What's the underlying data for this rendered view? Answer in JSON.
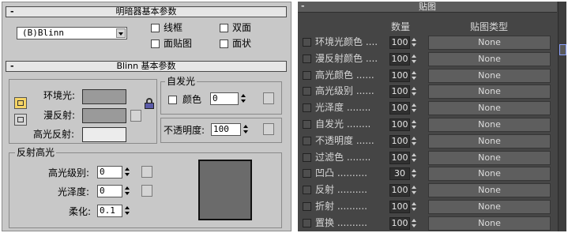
{
  "shader_rollout": {
    "title": "明暗器基本参数",
    "collapse_symbol": "-",
    "shader_value": "(B)Blinn",
    "options": [
      {
        "label": "线框",
        "checked": false
      },
      {
        "label": "双面",
        "checked": false
      },
      {
        "label": "面贴图",
        "checked": false
      },
      {
        "label": "面状",
        "checked": false
      }
    ]
  },
  "blinn_rollout": {
    "title": "Blinn 基本参数",
    "collapse_symbol": "-",
    "ambient_label": "环境光:",
    "diffuse_label": "漫反射:",
    "specular_label": "高光反射:",
    "colors": {
      "ambient": "#9a9a9a",
      "diffuse": "#9a9a9a",
      "specular": "#ececec",
      "preview": "#6b6b6b"
    },
    "self_illum": {
      "title": "自发光",
      "color_label": "颜色",
      "value": "0"
    },
    "opacity": {
      "label": "不透明度:",
      "value": "100"
    },
    "specular_highlights": {
      "title": "反射高光",
      "level_label": "高光级别:",
      "level_value": "0",
      "gloss_label": "光泽度:",
      "gloss_value": "0",
      "soften_label": "柔化:",
      "soften_value": "0.1"
    }
  },
  "maps_rollout": {
    "title": "贴图",
    "collapse_symbol": "-",
    "col_amount": "数量",
    "col_map_type": "贴图类型",
    "rows": [
      {
        "name": "环境光颜色 ....",
        "amount": "100",
        "map": "None"
      },
      {
        "name": "漫反射颜色 ....",
        "amount": "100",
        "map": "None"
      },
      {
        "name": "高光颜色 ......",
        "amount": "100",
        "map": "None"
      },
      {
        "name": "高光级别 ......",
        "amount": "100",
        "map": "None"
      },
      {
        "name": "光泽度 ........",
        "amount": "100",
        "map": "None"
      },
      {
        "name": "自发光 ........",
        "amount": "100",
        "map": "None"
      },
      {
        "name": "不透明度 ......",
        "amount": "100",
        "map": "None"
      },
      {
        "name": "过滤色 ........",
        "amount": "100",
        "map": "None"
      },
      {
        "name": "凹凸 ..........",
        "amount": "30",
        "map": "None"
      },
      {
        "name": "反射 ..........",
        "amount": "100",
        "map": "None"
      },
      {
        "name": "折射 ..........",
        "amount": "100",
        "map": "None"
      },
      {
        "name": "置换 ..........",
        "amount": "100",
        "map": "None"
      }
    ]
  }
}
